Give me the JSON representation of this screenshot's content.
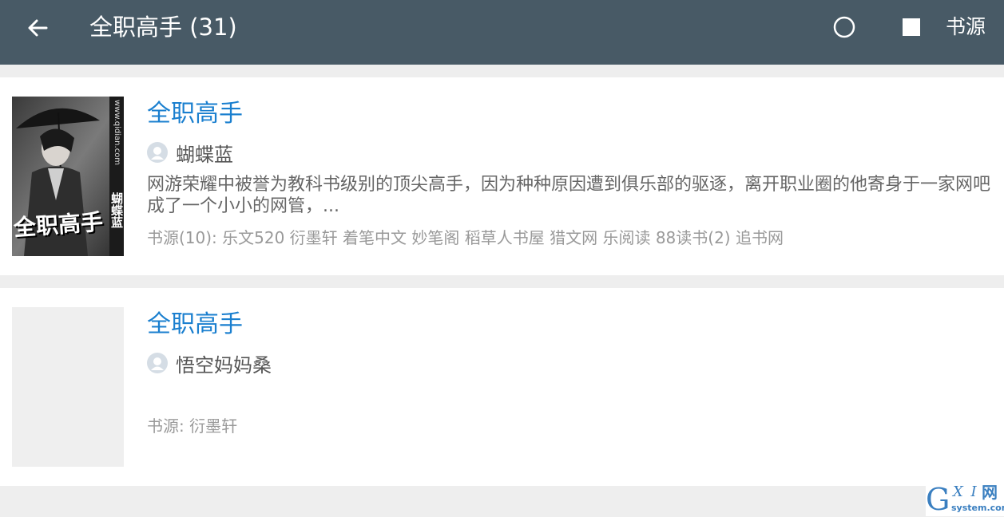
{
  "appbar": {
    "title": "全职高手 (31)",
    "back_icon": "arrow-left-icon",
    "refresh_icon": "circle-loading-icon",
    "stop_icon": "square-stop-icon",
    "source_label": "书源",
    "background_color": "#485a66"
  },
  "results": [
    {
      "title": "全职高手",
      "author": "蝴蝶蓝",
      "intro": "网游荣耀中被誉为教科书级别的顶尖高手，因为种种原因遭到俱乐部的驱逐，离开职业圈的他寄身于一家网吧成了一个小小的网管，...",
      "sources": "书源(10): 乐文520 衍墨轩 着笔中文 妙笔阁 稻草人书屋 猎文网 乐阅读 88读书(2) 追书网",
      "has_cover": true,
      "cover_text": {
        "title": "全职高手",
        "author": "蝴蝶蓝",
        "site": "www.qidian.com"
      }
    },
    {
      "title": "全职高手",
      "author": "悟空妈妈桑",
      "intro": "",
      "sources": "书源: 衍墨轩",
      "has_cover": false
    }
  ],
  "watermark": {
    "g": "G",
    "xi": "X I",
    "wang": "网",
    "domain": "system.com"
  },
  "colors": {
    "title_blue": "#1a7fcf",
    "page_background": "#eeeeee"
  }
}
